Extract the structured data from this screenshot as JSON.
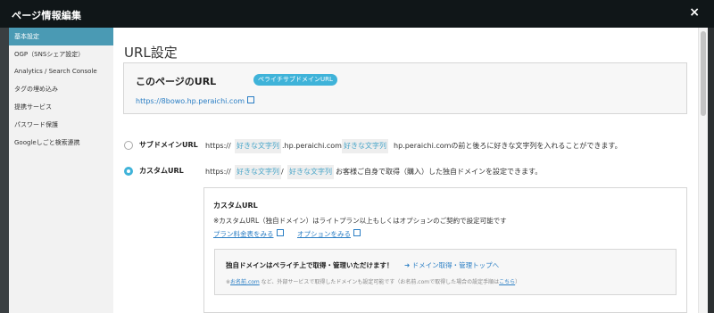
{
  "modal": {
    "title": "ページ情報編集",
    "close": "×"
  },
  "sidebar": {
    "items": [
      {
        "label": "基本設定"
      },
      {
        "label": "OGP（SNSシェア設定）"
      },
      {
        "label": "Analytics / Search Console"
      },
      {
        "label": "タグの埋め込み"
      },
      {
        "label": "提携サービス"
      },
      {
        "label": "パスワード保護"
      },
      {
        "label": "Googleしごと検索連携"
      }
    ]
  },
  "main": {
    "title": "URL設定",
    "current": {
      "label": "このページのURL",
      "badge": "ペライチサブドメインURL",
      "url": "https://8bowo.hp.peraichi.com"
    },
    "subdomain": {
      "label": "サブドメインURL",
      "prefix": "https://",
      "part1": "好きな文字列",
      "middle": ".hp.peraichi.com/",
      "part2": "好きな文字列",
      "desc": "hp.peraichi.comの前と後ろに好きな文字列を入れることができます。"
    },
    "custom": {
      "label": "カスタムURL",
      "prefix": "https://",
      "part1": "好きな文字列",
      "sep": "/",
      "part2": "好きな文字列",
      "desc": "お客様ご自身で取得（購入）した独自ドメインを設定できます。"
    },
    "custom_box": {
      "heading": "カスタムURL",
      "note": "※カスタムURL（独自ドメイン）はライトプラン以上もしくはオプションのご契約で設定可能です",
      "link_plans": "プラン料金表をみる",
      "link_options": "オプションをみる",
      "domain_text": "独自ドメインはペライチ上で取得・管理いただけます！",
      "domain_link": "ドメイン取得・管理トップへ",
      "small_prefix": "※",
      "small_link1": "お名前.com",
      "small_middle": " など、外部サービスで取得したドメインも設定可能です（お名前.comで取得した場合の設定手順は",
      "small_link2": "こちら",
      "small_suffix": "）"
    }
  }
}
